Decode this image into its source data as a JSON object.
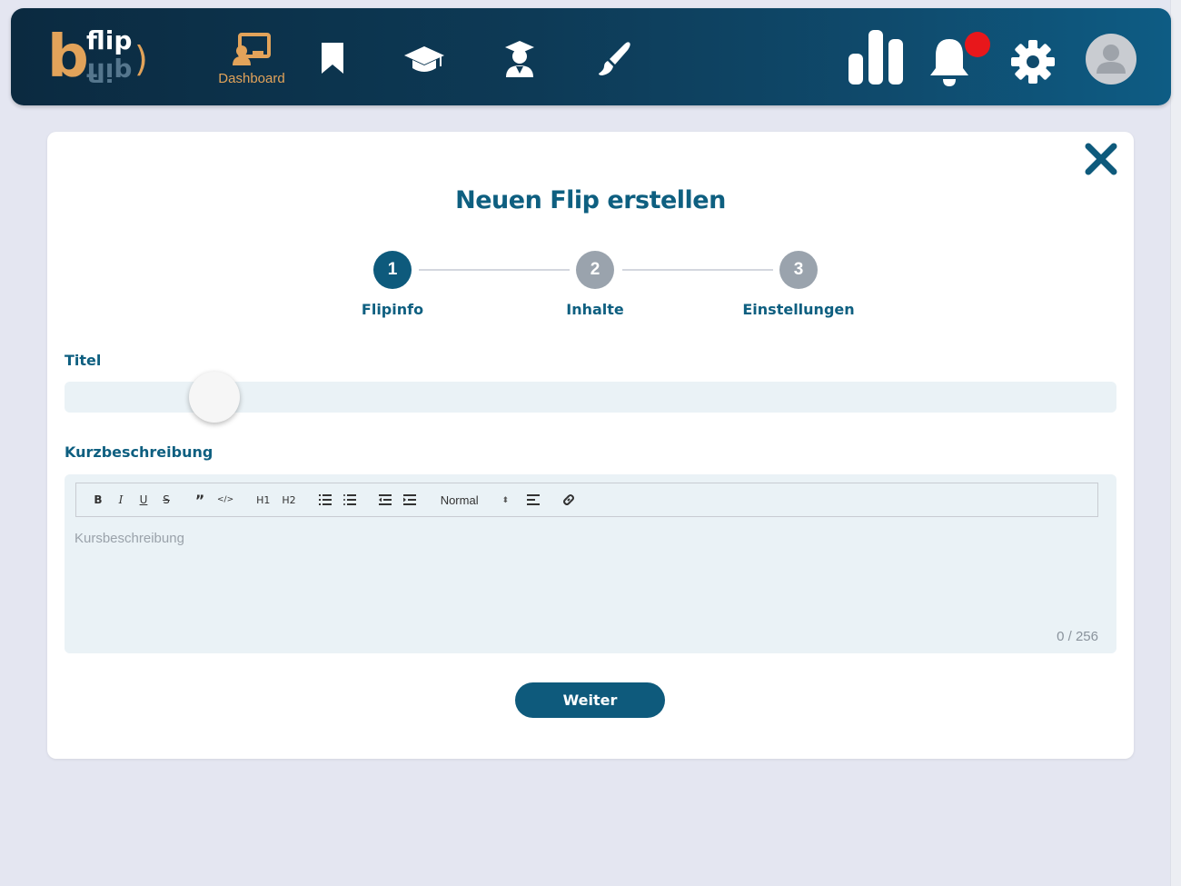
{
  "header": {
    "logo": {
      "letter": "b",
      "word": "flip",
      "paren": ")"
    },
    "nav": {
      "dashboard_label": "Dashboard"
    },
    "icons": [
      "dashboard-icon",
      "bookmark-icon",
      "graduation-cap-icon",
      "teacher-icon",
      "brush-icon",
      "stats-icon",
      "bell-icon",
      "gear-icon",
      "avatar-icon"
    ],
    "notification_dot_color": "#e8171b"
  },
  "dialog": {
    "title": "Neuen Flip erstellen",
    "steps": [
      {
        "number": "1",
        "label": "Flipinfo",
        "state": "active"
      },
      {
        "number": "2",
        "label": "Inhalte",
        "state": "inactive"
      },
      {
        "number": "3",
        "label": "Einstellungen",
        "state": "inactive"
      }
    ],
    "title_field": {
      "label": "Titel",
      "value": ""
    },
    "description": {
      "label": "Kurzbeschreibung",
      "placeholder": "Kursbeschreibung",
      "counter": "0 / 256",
      "toolbar": {
        "bold": "B",
        "italic": "I",
        "underline": "U",
        "strike": "S",
        "quote": "”",
        "code": "</>",
        "h1": "H1",
        "h2": "H2",
        "format_select": "Normal"
      }
    },
    "next_button": "Weiter"
  },
  "colors": {
    "primary": "#0e5a7c",
    "accent": "#e2a35a",
    "step_inactive": "#9aa3ad"
  }
}
